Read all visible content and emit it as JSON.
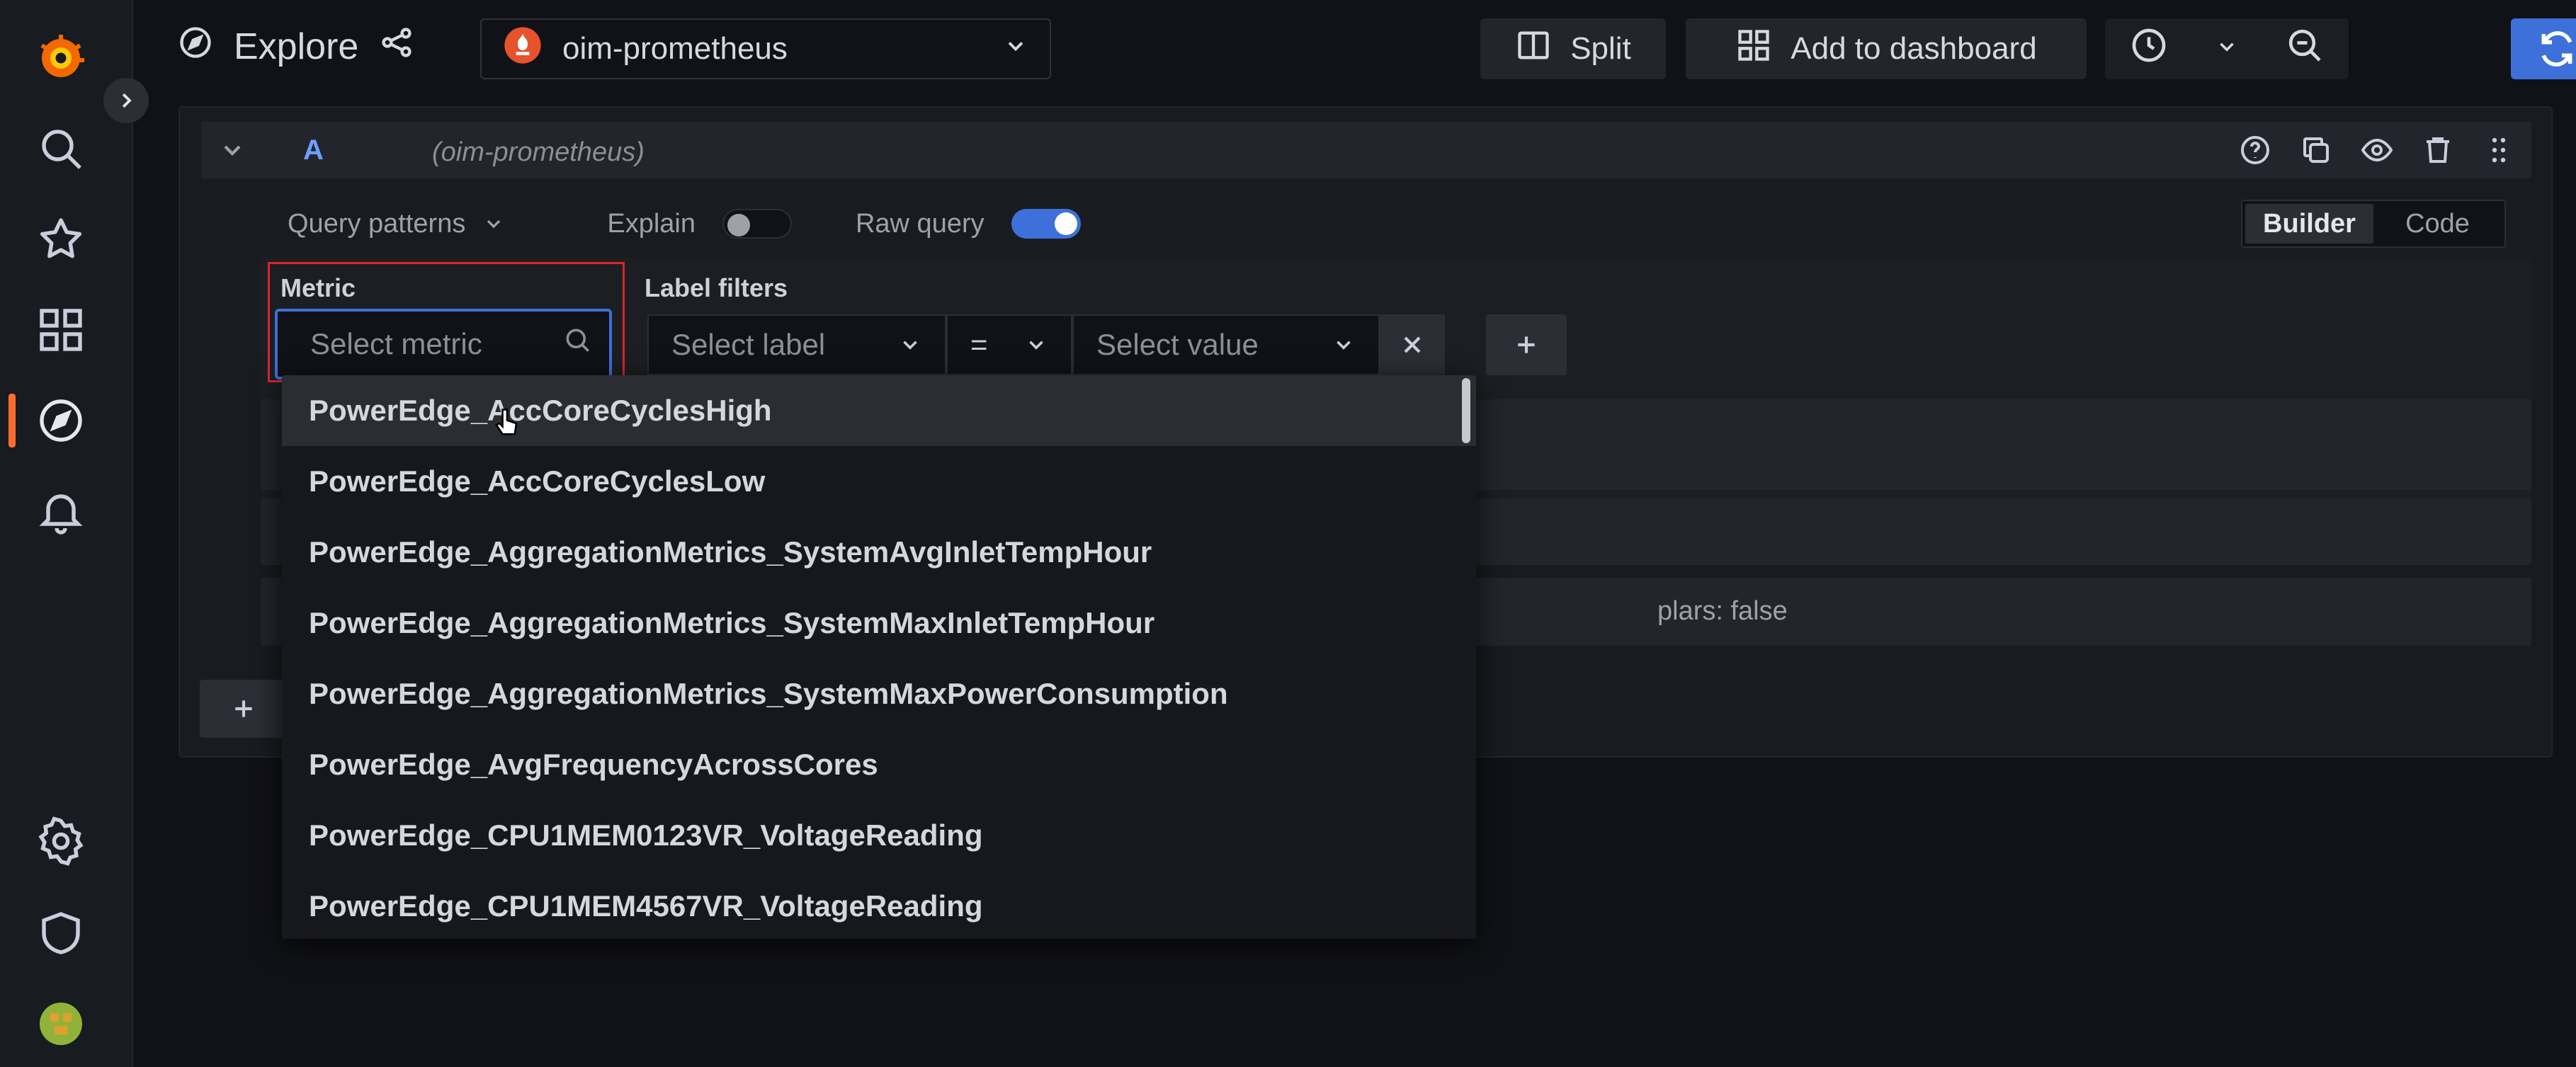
{
  "topbar": {
    "title": "Explore",
    "datasource": "oim-prometheus",
    "split_label": "Split",
    "add_dashboard_label": "Add to dashboard"
  },
  "query": {
    "letter": "A",
    "datasource_hint": "(oim-prometheus)",
    "query_patterns_label": "Query patterns",
    "explain_label": "Explain",
    "explain_on": false,
    "raw_query_label": "Raw query",
    "raw_query_on": true,
    "mode_builder": "Builder",
    "mode_code": "Code",
    "metric_label": "Metric",
    "metric_placeholder": "Select metric",
    "label_filters_label": "Label filters",
    "select_label_placeholder": "Select label",
    "operator": "=",
    "select_value_placeholder": "Select value",
    "options_partial": "plars: false"
  },
  "dropdown": {
    "items": [
      "PowerEdge_AccCoreCyclesHigh",
      "PowerEdge_AccCoreCyclesLow",
      "PowerEdge_AggregationMetrics_SystemAvgInletTempHour",
      "PowerEdge_AggregationMetrics_SystemMaxInletTempHour",
      "PowerEdge_AggregationMetrics_SystemMaxPowerConsumption",
      "PowerEdge_AvgFrequencyAcrossCores",
      "PowerEdge_CPU1MEM0123VR_VoltageReading",
      "PowerEdge_CPU1MEM4567VR_VoltageReading"
    ],
    "highlighted_index": 0
  },
  "icons": {
    "logo": "grafana-logo-icon",
    "search": "search-icon",
    "starred": "star-icon",
    "dashboards": "dashboards-grid-icon",
    "explore": "compass-icon",
    "alerting": "bell-icon",
    "settings": "gear-icon",
    "admin": "shield-icon",
    "user": "avatar-icon"
  },
  "colors": {
    "accent": "#3d71d9",
    "brand": "#ff6d2e",
    "highlight_box": "#d9262c"
  }
}
